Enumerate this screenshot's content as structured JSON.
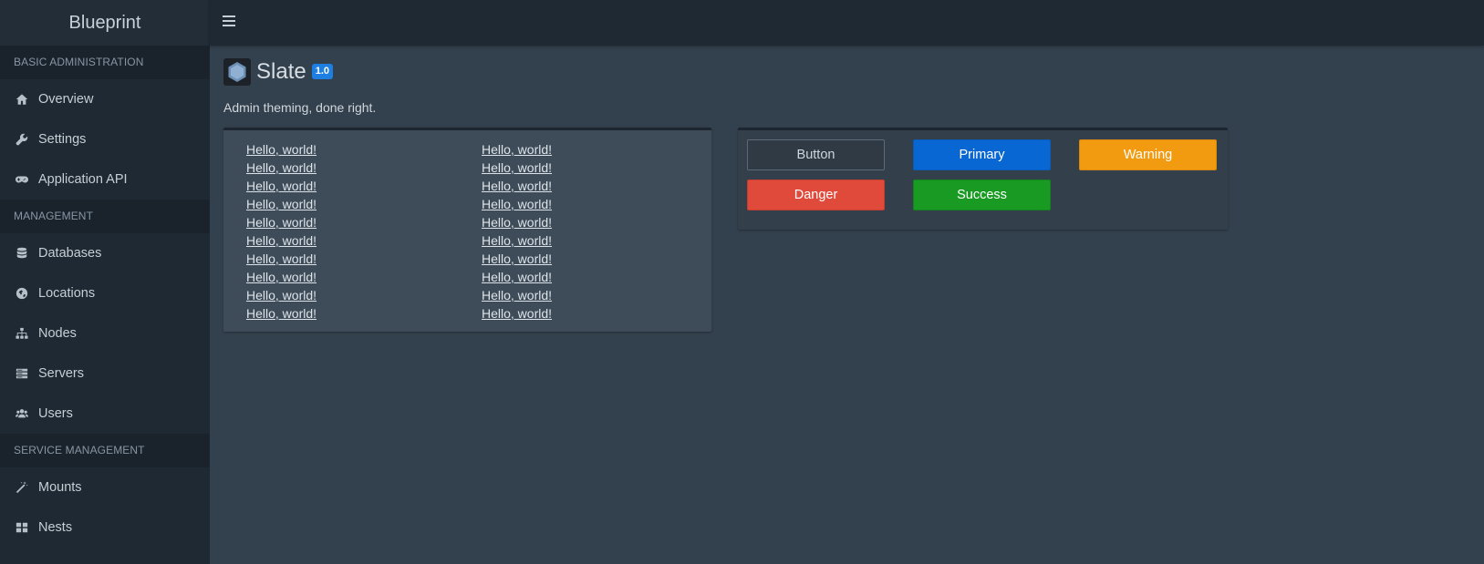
{
  "brand": "Blueprint",
  "sidebar": {
    "sections": [
      {
        "header": "Basic Administration",
        "items": [
          {
            "label": "Overview",
            "icon": "home-icon"
          },
          {
            "label": "Settings",
            "icon": "wrench-icon"
          },
          {
            "label": "Application API",
            "icon": "gamepad-icon"
          }
        ]
      },
      {
        "header": "Management",
        "items": [
          {
            "label": "Databases",
            "icon": "database-icon"
          },
          {
            "label": "Locations",
            "icon": "globe-icon"
          },
          {
            "label": "Nodes",
            "icon": "sitemap-icon"
          },
          {
            "label": "Servers",
            "icon": "server-icon"
          },
          {
            "label": "Users",
            "icon": "users-icon"
          }
        ]
      },
      {
        "header": "Service Management",
        "items": [
          {
            "label": "Mounts",
            "icon": "magic-wand-icon"
          },
          {
            "label": "Nests",
            "icon": "th-large-icon"
          }
        ]
      }
    ]
  },
  "page": {
    "title": "Slate",
    "version": "1.0",
    "tagline": "Admin theming, done right."
  },
  "links": {
    "col1": [
      "Hello, world!",
      "Hello, world!",
      "Hello, world!",
      "Hello, world!",
      "Hello, world!",
      "Hello, world!",
      "Hello, world!",
      "Hello, world!",
      "Hello, world!",
      "Hello, world!"
    ],
    "col2": [
      "Hello, world!",
      "Hello, world!",
      "Hello, world!",
      "Hello, world!",
      "Hello, world!",
      "Hello, world!",
      "Hello, world!",
      "Hello, world!",
      "Hello, world!",
      "Hello, world!"
    ]
  },
  "buttons": {
    "default": "Button",
    "primary": "Primary",
    "warning": "Warning",
    "danger": "Danger",
    "success": "Success"
  },
  "colors": {
    "sidebar_bg": "#1f2933",
    "content_bg": "#33404d",
    "primary": "#0967d3",
    "warning": "#f29b11",
    "danger": "#e04a3a",
    "success": "#189a23",
    "version_badge": "#1e7fe0"
  }
}
